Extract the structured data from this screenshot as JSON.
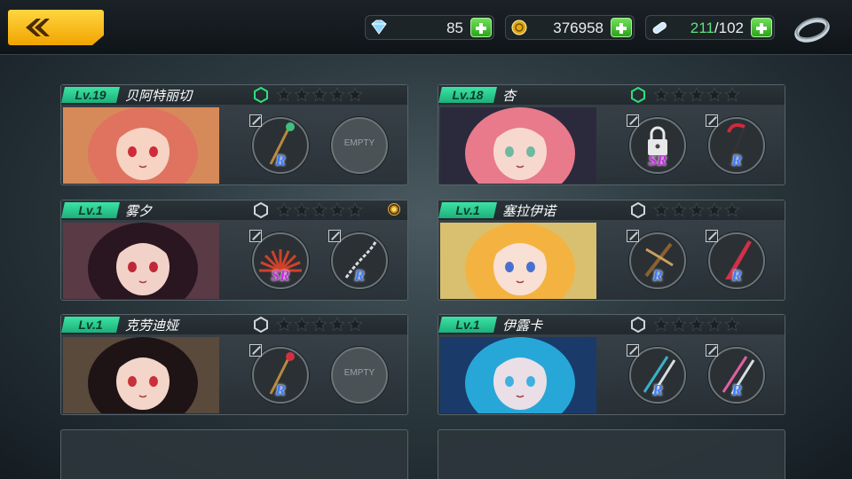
{
  "topbar": {
    "diamonds": "85",
    "gold": "376958",
    "stamina_current": "211",
    "stamina_separator": "/",
    "stamina_max": "102",
    "icons": [
      "back-arrow-icon",
      "diamond-icon",
      "gold-coin-icon",
      "stamina-capsule-icon",
      "plus-icon",
      "ring-icon"
    ]
  },
  "empty_label": "EMPTY",
  "characters": [
    {
      "level": "Lv.19",
      "name": "贝阿特丽切",
      "stars": 0,
      "star_max": 5,
      "badge_active": true,
      "notify": false,
      "slots": [
        {
          "kind": "staff",
          "rarity": "R"
        },
        {
          "kind": "empty",
          "rarity": ""
        }
      ],
      "portrait": {
        "hair": "#e0735f",
        "skin": "#f6d3c2",
        "bg": "#d68a5a",
        "eyes": "#d02a3a"
      }
    },
    {
      "level": "Lv.18",
      "name": "杏",
      "stars": 0,
      "star_max": 5,
      "badge_active": true,
      "notify": false,
      "slots": [
        {
          "kind": "locked",
          "rarity": "SR"
        },
        {
          "kind": "scythe",
          "rarity": "R"
        }
      ],
      "portrait": {
        "hair": "#e87a8c",
        "skin": "#f7d8cf",
        "bg": "#2b2a3c",
        "eyes": "#6fb9a0"
      }
    },
    {
      "level": "Lv.1",
      "name": "雾夕",
      "stars": 0,
      "star_max": 5,
      "badge_active": false,
      "notify": true,
      "slots": [
        {
          "kind": "fan",
          "rarity": "SR"
        },
        {
          "kind": "chain",
          "rarity": "R"
        }
      ],
      "portrait": {
        "hair": "#2a1620",
        "skin": "#f2d2c8",
        "bg": "#5a3a44",
        "eyes": "#c0283a"
      }
    },
    {
      "level": "Lv.1",
      "name": "塞拉伊诺",
      "stars": 0,
      "star_max": 5,
      "badge_active": false,
      "notify": false,
      "slots": [
        {
          "kind": "crossbow",
          "rarity": "R"
        },
        {
          "kind": "blade",
          "rarity": "R"
        }
      ],
      "portrait": {
        "hair": "#f4b340",
        "skin": "#f9e0d4",
        "bg": "#d9c070",
        "eyes": "#4a6fd0"
      }
    },
    {
      "level": "Lv.1",
      "name": "克劳迪娅",
      "stars": 0,
      "star_max": 5,
      "badge_active": false,
      "notify": false,
      "slots": [
        {
          "kind": "rose-staff",
          "rarity": "R"
        },
        {
          "kind": "empty",
          "rarity": ""
        }
      ],
      "portrait": {
        "hair": "#1e1416",
        "skin": "#f4d5c9",
        "bg": "#5a4a3c",
        "eyes": "#c8303a"
      }
    },
    {
      "level": "Lv.1",
      "name": "伊露卡",
      "stars": 0,
      "star_max": 5,
      "badge_active": false,
      "notify": false,
      "slots": [
        {
          "kind": "twin-swords",
          "rarity": "R"
        },
        {
          "kind": "twin-daggers",
          "rarity": "R"
        }
      ],
      "portrait": {
        "hair": "#27a7d8",
        "skin": "#eadfe6",
        "bg": "#1a3a6a",
        "eyes": "#3fb0e0"
      }
    }
  ],
  "colors": {
    "accent": "#f1b300",
    "level_tag": "#27c98c",
    "rarity_R": "#3a7bff",
    "rarity_SR": "#c22fe0"
  }
}
